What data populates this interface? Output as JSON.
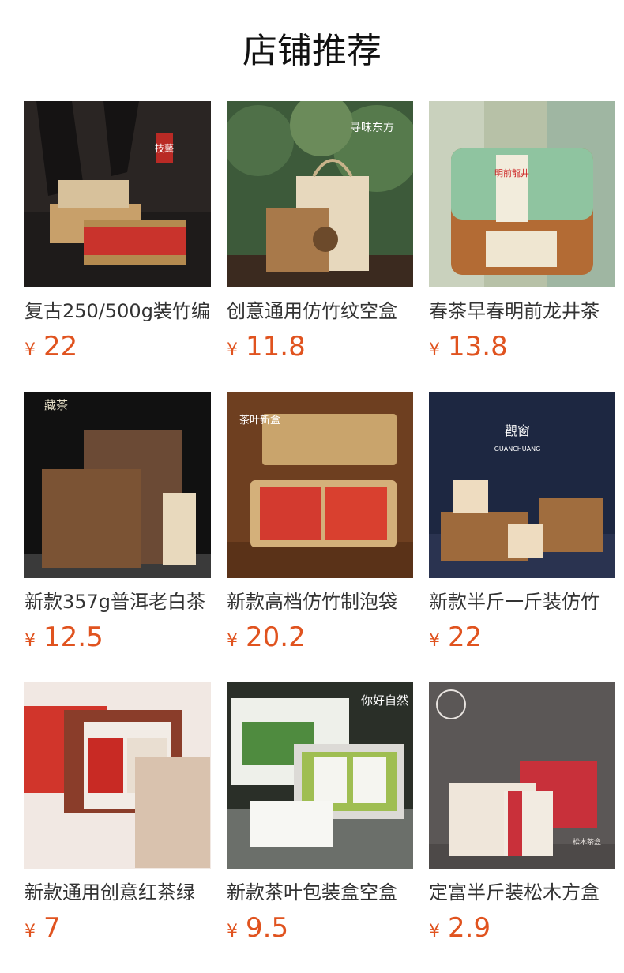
{
  "header": {
    "title": "店铺推荐"
  },
  "products": [
    {
      "name": "复古250/500g装竹编",
      "currency": "¥",
      "price": "22",
      "badge": "技藝",
      "image": "bamboo-tea-box"
    },
    {
      "name": "创意通用仿竹纹空盒",
      "currency": "¥",
      "price": "11.8",
      "badge": "寻味东方",
      "image": "bamboo-pattern-gift-box"
    },
    {
      "name": "春茶早春明前龙井茶",
      "currency": "¥",
      "price": "13.8",
      "badge": "明前龍井",
      "image": "longjing-tea-box"
    },
    {
      "name": "新款357g普洱老白茶",
      "currency": "¥",
      "price": "12.5",
      "badge": "藏茶",
      "image": "puer-wood-box"
    },
    {
      "name": "新款高档仿竹制泡袋",
      "currency": "¥",
      "price": "20.2",
      "badge": "茶叶新盒",
      "image": "bamboo-bag-box"
    },
    {
      "name": "新款半斤一斤装仿竹",
      "currency": "¥",
      "price": "22",
      "badge": "觀窗",
      "badge_sub": "GUANCHUANG",
      "image": "guanchuang-box"
    },
    {
      "name": "新款通用创意红茶绿",
      "currency": "¥",
      "price": "7",
      "badge": "",
      "image": "red-tea-gift-box"
    },
    {
      "name": "新款茶叶包装盒空盒",
      "currency": "¥",
      "price": "9.5",
      "badge": "你好自然",
      "image": "green-tea-tin-box"
    },
    {
      "name": "定富半斤装松木方盒",
      "currency": "¥",
      "price": "2.9",
      "badge": "松木茶盒",
      "image": "pine-wood-box"
    }
  ]
}
